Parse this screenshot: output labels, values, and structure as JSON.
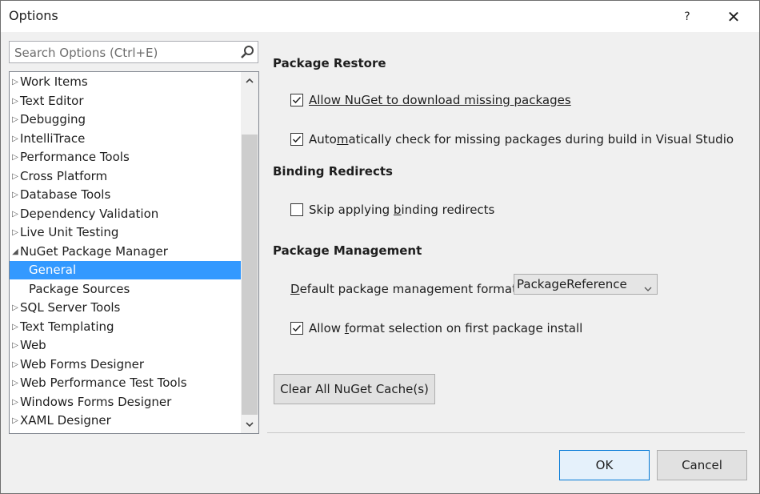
{
  "window": {
    "title": "Options",
    "help_label": "?",
    "close_label": "✕"
  },
  "search": {
    "placeholder": "Search Options (Ctrl+E)"
  },
  "tree": {
    "items": [
      {
        "label": "Work Items",
        "arrow": "▷"
      },
      {
        "label": "Text Editor",
        "arrow": "▷"
      },
      {
        "label": "Debugging",
        "arrow": "▷"
      },
      {
        "label": "IntelliTrace",
        "arrow": "▷"
      },
      {
        "label": "Performance Tools",
        "arrow": "▷"
      },
      {
        "label": "Cross Platform",
        "arrow": "▷"
      },
      {
        "label": "Database Tools",
        "arrow": "▷"
      },
      {
        "label": "Dependency Validation",
        "arrow": "▷"
      },
      {
        "label": "Live Unit Testing",
        "arrow": "▷"
      },
      {
        "label": "NuGet Package Manager",
        "arrow": "◢"
      },
      {
        "label": "General",
        "arrow": "",
        "selected": true
      },
      {
        "label": "Package Sources",
        "arrow": ""
      },
      {
        "label": "SQL Server Tools",
        "arrow": "▷"
      },
      {
        "label": "Text Templating",
        "arrow": "▷"
      },
      {
        "label": "Web",
        "arrow": "▷"
      },
      {
        "label": "Web Forms Designer",
        "arrow": "▷"
      },
      {
        "label": "Web Performance Test Tools",
        "arrow": "▷"
      },
      {
        "label": "Windows Forms Designer",
        "arrow": "▷"
      },
      {
        "label": "XAML Designer",
        "arrow": "▷"
      }
    ]
  },
  "package_restore": {
    "heading": "Package Restore",
    "allow_download": {
      "label_pre": "Allow NuGet to download missing packages",
      "checked": true
    },
    "auto_check": {
      "label_pre": "Auto",
      "label_acc": "m",
      "label_post": "atically check for missing packages during build in Visual Studio",
      "checked": true
    }
  },
  "binding_redirects": {
    "heading": "Binding Redirects",
    "skip": {
      "label_pre": "Skip applying ",
      "label_acc": "b",
      "label_post": "inding redirects",
      "checked": false
    }
  },
  "package_management": {
    "heading": "Package Management",
    "format_label_acc": "D",
    "format_label_post": "efault package management format:",
    "format_value": "PackageReference",
    "allow_selection": {
      "label_pre": "Allow ",
      "label_acc": "f",
      "label_post": "ormat selection on first package install",
      "checked": true
    }
  },
  "buttons": {
    "clear_cache": "Clear All NuGet Cache(s)",
    "ok": "OK",
    "cancel": "Cancel"
  },
  "colors": {
    "selection": "#3399ff",
    "default_button_border": "#0078d7"
  }
}
